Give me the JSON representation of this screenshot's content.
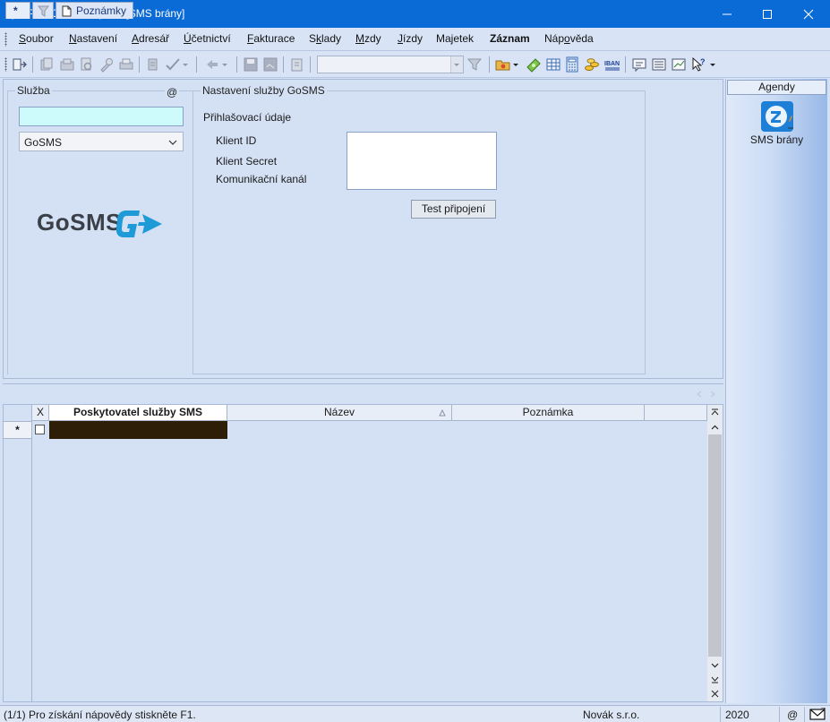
{
  "window": {
    "title": "POHODA Komplet - [SMS brány]",
    "minimize_glyph": "minimize-icon",
    "maximize_glyph": "maximize-icon",
    "close_glyph": "close-icon"
  },
  "menu": [
    {
      "label": "Soubor",
      "underline": "S"
    },
    {
      "label": "Nastavení",
      "underline": "N"
    },
    {
      "label": "Adresář",
      "underline": "A"
    },
    {
      "label": "Účetnictví",
      "underline": "Ú"
    },
    {
      "label": "Fakturace",
      "underline": "F"
    },
    {
      "label": "Sklady",
      "underline": "k"
    },
    {
      "label": "Mzdy",
      "underline": "M"
    },
    {
      "label": "Jízdy",
      "underline": "J"
    },
    {
      "label": "Majetek",
      "underline": "j"
    },
    {
      "label": "Záznam",
      "underline": ""
    },
    {
      "label": "Nápověda",
      "underline": "o"
    }
  ],
  "sluzba": {
    "legend": "Služba",
    "at_symbol": "@",
    "input_value": "",
    "selected_service": "GoSMS",
    "logo_text": "GoSMS"
  },
  "gosms_settings": {
    "legend": "Nastavení služby GoSMS",
    "section_label": "Přihlašovací údaje",
    "client_id_label": "Klient ID",
    "client_secret_label": "Klient Secret",
    "channel_label": "Komunikační kanál",
    "test_button": "Test připojení"
  },
  "tabs": {
    "star": "*",
    "notes": "Poznámky"
  },
  "grid": {
    "columns": [
      "X",
      "Poskytovatel služby SMS",
      "Název",
      "Poznámka"
    ],
    "new_row_marker": "*"
  },
  "agendy": {
    "header": "Agendy",
    "items": [
      {
        "label": "SMS brány"
      }
    ]
  },
  "status": {
    "help": "(1/1) Pro získání nápovědy stiskněte F1.",
    "company": "Novák s.r.o.",
    "year": "2020",
    "at": "@"
  },
  "colors": {
    "titlebar": "#0b6bd6",
    "sluzba_input": "#cdfafb",
    "logo_accent": "#1e9bd7",
    "dark_cell": "#2e1e08"
  }
}
